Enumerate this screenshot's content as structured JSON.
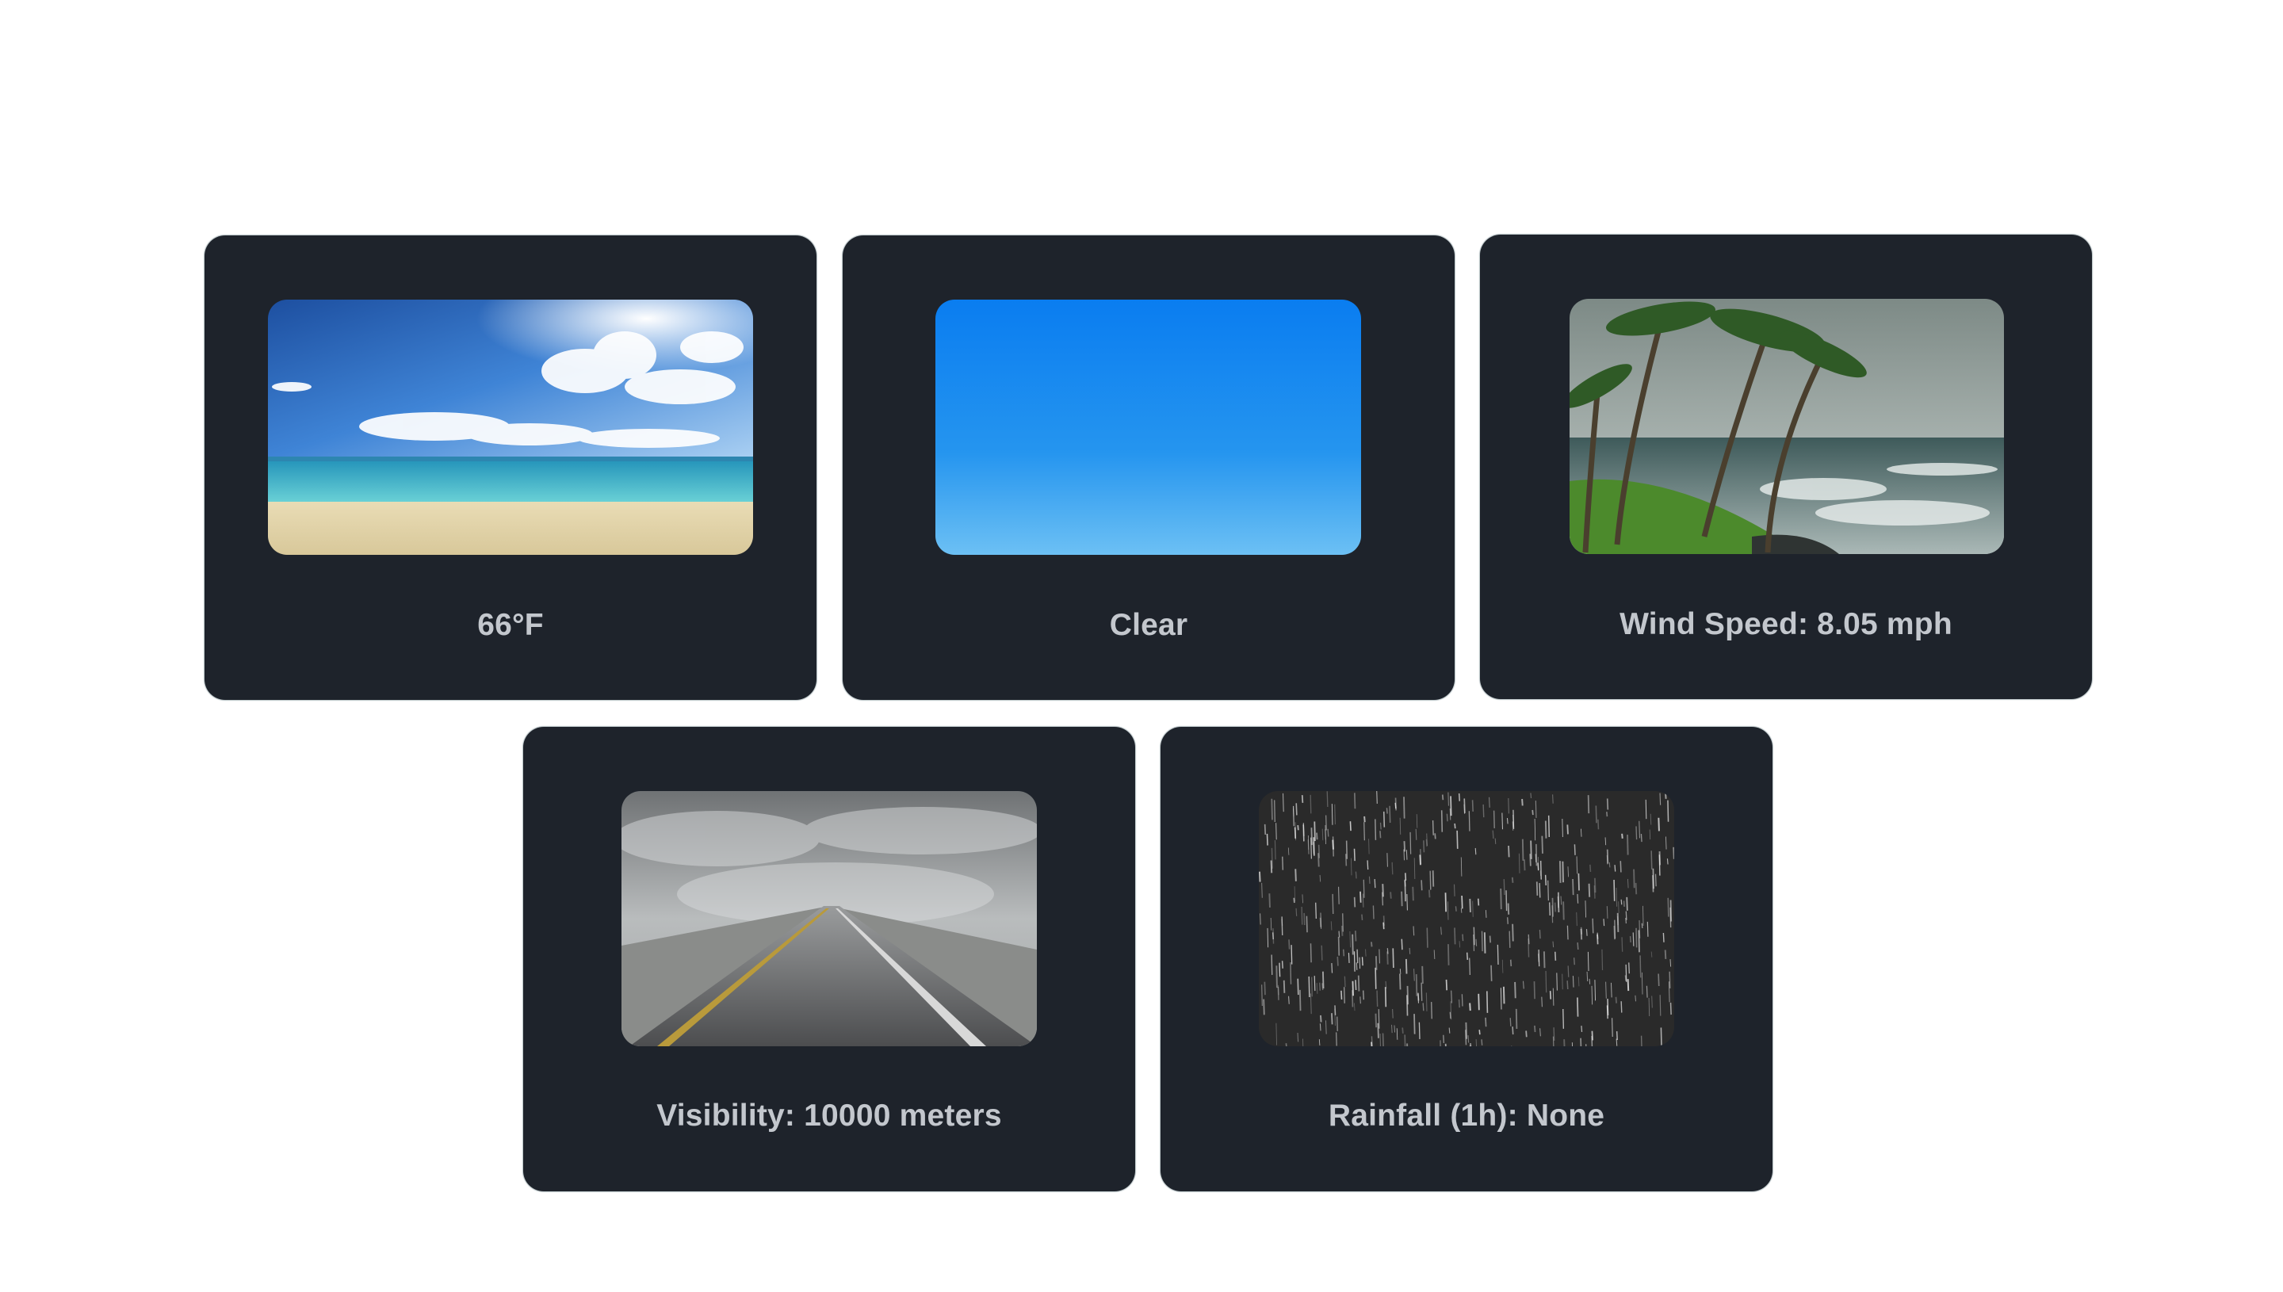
{
  "cards": [
    {
      "label": "66°F",
      "image": "sunny-beach-image"
    },
    {
      "label": "Clear",
      "image": "clear-sky-image"
    },
    {
      "label": "Wind Speed: 8.05 mph",
      "image": "windy-palms-image"
    },
    {
      "label": "Visibility: 10000 meters",
      "image": "foggy-road-image"
    },
    {
      "label": "Rainfall (1h): None",
      "image": "rain-streaks-image"
    }
  ]
}
